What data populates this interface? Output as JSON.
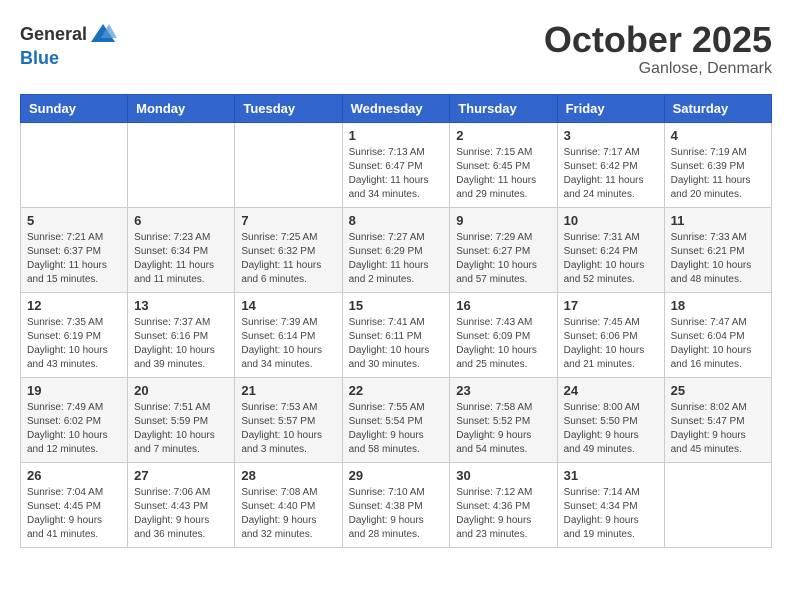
{
  "logo": {
    "general": "General",
    "blue": "Blue"
  },
  "title": "October 2025",
  "location": "Ganlose, Denmark",
  "days_header": [
    "Sunday",
    "Monday",
    "Tuesday",
    "Wednesday",
    "Thursday",
    "Friday",
    "Saturday"
  ],
  "weeks": [
    [
      {
        "day": "",
        "info": ""
      },
      {
        "day": "",
        "info": ""
      },
      {
        "day": "",
        "info": ""
      },
      {
        "day": "1",
        "info": "Sunrise: 7:13 AM\nSunset: 6:47 PM\nDaylight: 11 hours\nand 34 minutes."
      },
      {
        "day": "2",
        "info": "Sunrise: 7:15 AM\nSunset: 6:45 PM\nDaylight: 11 hours\nand 29 minutes."
      },
      {
        "day": "3",
        "info": "Sunrise: 7:17 AM\nSunset: 6:42 PM\nDaylight: 11 hours\nand 24 minutes."
      },
      {
        "day": "4",
        "info": "Sunrise: 7:19 AM\nSunset: 6:39 PM\nDaylight: 11 hours\nand 20 minutes."
      }
    ],
    [
      {
        "day": "5",
        "info": "Sunrise: 7:21 AM\nSunset: 6:37 PM\nDaylight: 11 hours\nand 15 minutes."
      },
      {
        "day": "6",
        "info": "Sunrise: 7:23 AM\nSunset: 6:34 PM\nDaylight: 11 hours\nand 11 minutes."
      },
      {
        "day": "7",
        "info": "Sunrise: 7:25 AM\nSunset: 6:32 PM\nDaylight: 11 hours\nand 6 minutes."
      },
      {
        "day": "8",
        "info": "Sunrise: 7:27 AM\nSunset: 6:29 PM\nDaylight: 11 hours\nand 2 minutes."
      },
      {
        "day": "9",
        "info": "Sunrise: 7:29 AM\nSunset: 6:27 PM\nDaylight: 10 hours\nand 57 minutes."
      },
      {
        "day": "10",
        "info": "Sunrise: 7:31 AM\nSunset: 6:24 PM\nDaylight: 10 hours\nand 52 minutes."
      },
      {
        "day": "11",
        "info": "Sunrise: 7:33 AM\nSunset: 6:21 PM\nDaylight: 10 hours\nand 48 minutes."
      }
    ],
    [
      {
        "day": "12",
        "info": "Sunrise: 7:35 AM\nSunset: 6:19 PM\nDaylight: 10 hours\nand 43 minutes."
      },
      {
        "day": "13",
        "info": "Sunrise: 7:37 AM\nSunset: 6:16 PM\nDaylight: 10 hours\nand 39 minutes."
      },
      {
        "day": "14",
        "info": "Sunrise: 7:39 AM\nSunset: 6:14 PM\nDaylight: 10 hours\nand 34 minutes."
      },
      {
        "day": "15",
        "info": "Sunrise: 7:41 AM\nSunset: 6:11 PM\nDaylight: 10 hours\nand 30 minutes."
      },
      {
        "day": "16",
        "info": "Sunrise: 7:43 AM\nSunset: 6:09 PM\nDaylight: 10 hours\nand 25 minutes."
      },
      {
        "day": "17",
        "info": "Sunrise: 7:45 AM\nSunset: 6:06 PM\nDaylight: 10 hours\nand 21 minutes."
      },
      {
        "day": "18",
        "info": "Sunrise: 7:47 AM\nSunset: 6:04 PM\nDaylight: 10 hours\nand 16 minutes."
      }
    ],
    [
      {
        "day": "19",
        "info": "Sunrise: 7:49 AM\nSunset: 6:02 PM\nDaylight: 10 hours\nand 12 minutes."
      },
      {
        "day": "20",
        "info": "Sunrise: 7:51 AM\nSunset: 5:59 PM\nDaylight: 10 hours\nand 7 minutes."
      },
      {
        "day": "21",
        "info": "Sunrise: 7:53 AM\nSunset: 5:57 PM\nDaylight: 10 hours\nand 3 minutes."
      },
      {
        "day": "22",
        "info": "Sunrise: 7:55 AM\nSunset: 5:54 PM\nDaylight: 9 hours\nand 58 minutes."
      },
      {
        "day": "23",
        "info": "Sunrise: 7:58 AM\nSunset: 5:52 PM\nDaylight: 9 hours\nand 54 minutes."
      },
      {
        "day": "24",
        "info": "Sunrise: 8:00 AM\nSunset: 5:50 PM\nDaylight: 9 hours\nand 49 minutes."
      },
      {
        "day": "25",
        "info": "Sunrise: 8:02 AM\nSunset: 5:47 PM\nDaylight: 9 hours\nand 45 minutes."
      }
    ],
    [
      {
        "day": "26",
        "info": "Sunrise: 7:04 AM\nSunset: 4:45 PM\nDaylight: 9 hours\nand 41 minutes."
      },
      {
        "day": "27",
        "info": "Sunrise: 7:06 AM\nSunset: 4:43 PM\nDaylight: 9 hours\nand 36 minutes."
      },
      {
        "day": "28",
        "info": "Sunrise: 7:08 AM\nSunset: 4:40 PM\nDaylight: 9 hours\nand 32 minutes."
      },
      {
        "day": "29",
        "info": "Sunrise: 7:10 AM\nSunset: 4:38 PM\nDaylight: 9 hours\nand 28 minutes."
      },
      {
        "day": "30",
        "info": "Sunrise: 7:12 AM\nSunset: 4:36 PM\nDaylight: 9 hours\nand 23 minutes."
      },
      {
        "day": "31",
        "info": "Sunrise: 7:14 AM\nSunset: 4:34 PM\nDaylight: 9 hours\nand 19 minutes."
      },
      {
        "day": "",
        "info": ""
      }
    ]
  ]
}
